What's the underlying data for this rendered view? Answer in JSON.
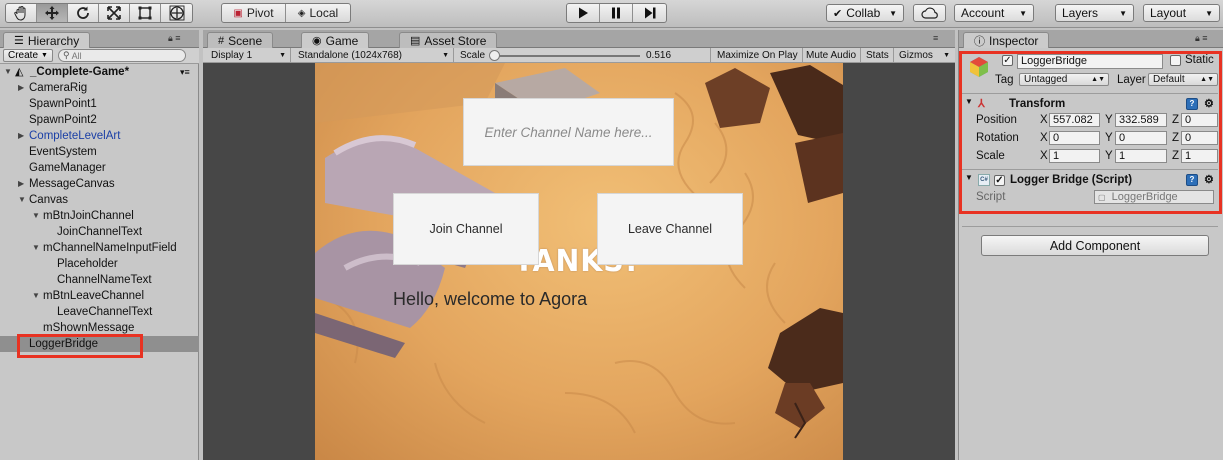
{
  "toolbar": {
    "tools": [
      "hand-tool-icon",
      "move-tool-icon",
      "rotate-tool-icon",
      "scale-tool-icon",
      "rect-tool-icon",
      "transform-tool-icon"
    ],
    "pivot": "Pivot",
    "local": "Local",
    "collab": "Collab",
    "account": "Account",
    "layers": "Layers",
    "layout": "Layout"
  },
  "hierarchy": {
    "tab": "Hierarchy",
    "create": "Create",
    "search_placeholder": "All",
    "scene": "_Complete-Game*",
    "items": [
      {
        "label": "CameraRig"
      },
      {
        "label": "SpawnPoint1"
      },
      {
        "label": "SpawnPoint2"
      },
      {
        "label": "CompleteLevelArt"
      },
      {
        "label": "EventSystem"
      },
      {
        "label": "GameManager"
      },
      {
        "label": "MessageCanvas"
      },
      {
        "label": "Canvas"
      },
      {
        "label": "mBtnJoinChannel"
      },
      {
        "label": "JoinChannelText"
      },
      {
        "label": "mChannelNameInputField"
      },
      {
        "label": "Placeholder"
      },
      {
        "label": "ChannelNameText"
      },
      {
        "label": "mBtnLeaveChannel"
      },
      {
        "label": "LeaveChannelText"
      },
      {
        "label": "mShownMessage"
      },
      {
        "label": "LoggerBridge"
      }
    ]
  },
  "center": {
    "tabs": [
      "Scene",
      "Game",
      "Asset Store"
    ],
    "display": "Display 1",
    "resolution": "Standalone (1024x768)",
    "scale_label": "Scale",
    "scale_value": "0.516",
    "maximize": "Maximize On Play",
    "mute": "Mute Audio",
    "stats": "Stats",
    "gizmos": "Gizmos"
  },
  "game": {
    "input_placeholder": "Enter Channel Name here...",
    "join_button": "Join Channel",
    "leave_button": "Leave Channel",
    "logo": "TANKS!",
    "message": "Hello, welcome to Agora"
  },
  "inspector": {
    "tab": "Inspector",
    "object_name": "LoggerBridge",
    "static_label": "Static",
    "tag_label": "Tag",
    "tag_value": "Untagged",
    "layer_label": "Layer",
    "layer_value": "Default",
    "transform": {
      "title": "Transform",
      "position_label": "Position",
      "rotation_label": "Rotation",
      "scale_label": "Scale",
      "position": {
        "x": "557.082",
        "y": "332.589",
        "z": "0"
      },
      "rotation": {
        "x": "0",
        "y": "0",
        "z": "0"
      },
      "scale": {
        "x": "1",
        "y": "1",
        "z": "1"
      }
    },
    "script_comp": {
      "title": "Logger Bridge (Script)",
      "script_label": "Script",
      "script_value": "LoggerBridge"
    },
    "add_component": "Add Component"
  }
}
